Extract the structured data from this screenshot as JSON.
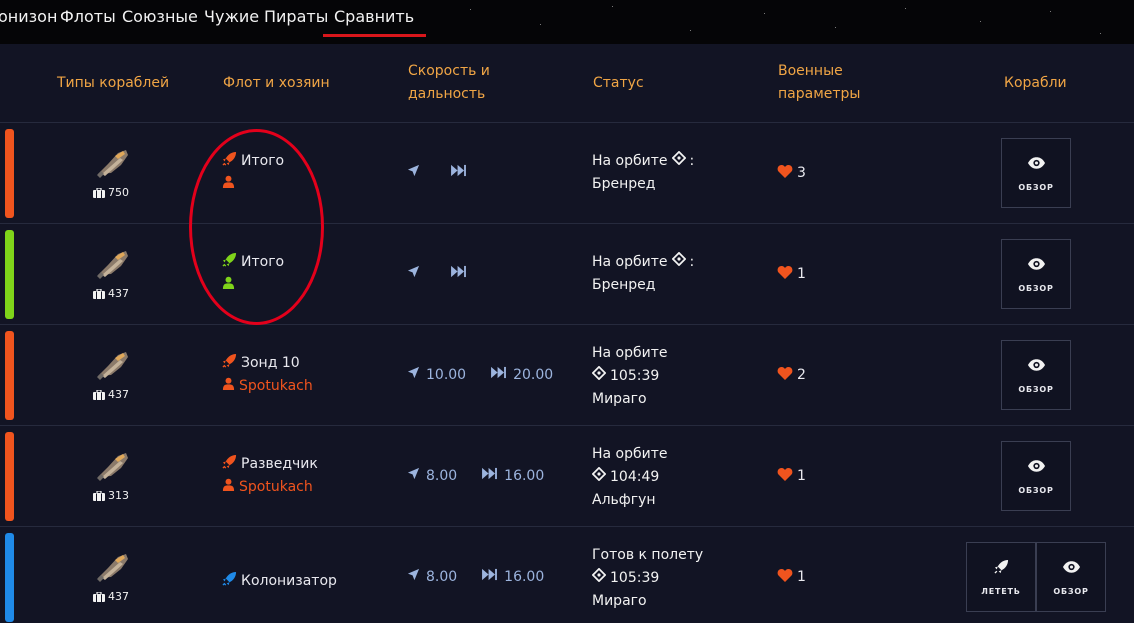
{
  "tabs": [
    "онизон",
    "Флоты",
    "Союзные",
    "Чужие",
    "Пираты",
    "Сравнить"
  ],
  "active_tab": "Сравнить",
  "columns": {
    "types": "Типы кораблей",
    "fleet": "Флот и хозяин",
    "speed": "Скорость и дальность",
    "status": "Статус",
    "military": "Военные параметры",
    "ships": "Корабли"
  },
  "colors": {
    "orange": "#f0541e",
    "green": "#7fd41a",
    "blue": "#1f8ae8",
    "accent_header": "#f0a545",
    "underline": "#d8161b"
  },
  "rows": [
    {
      "stripe": "orange",
      "cargo": "750",
      "fleet_name": "Итого",
      "owner": "",
      "speed": "",
      "range": "",
      "status": [
        "На орбите",
        ":",
        "Бренред"
      ],
      "hp": "3",
      "buttons": [
        "ОБЗОР"
      ]
    },
    {
      "stripe": "green",
      "cargo": "437",
      "fleet_name": "Итого",
      "owner": "",
      "speed": "",
      "range": "",
      "status": [
        "На орбите",
        ":",
        "Бренред"
      ],
      "hp": "1",
      "buttons": [
        "ОБЗОР"
      ]
    },
    {
      "stripe": "orange",
      "cargo": "437",
      "fleet_name": "Зонд 10",
      "owner": "Spotukach",
      "speed": "10.00",
      "range": "20.00",
      "status": [
        "На орбите",
        "105:39",
        "Мираго"
      ],
      "hp": "2",
      "buttons": [
        "ОБЗОР"
      ]
    },
    {
      "stripe": "orange",
      "cargo": "313",
      "fleet_name": "Разведчик",
      "owner": "Spotukach",
      "speed": "8.00",
      "range": "16.00",
      "status": [
        "На орбите",
        "104:49",
        "Альфгун"
      ],
      "hp": "1",
      "buttons": [
        "ОБЗОР"
      ]
    },
    {
      "stripe": "blue",
      "cargo": "437",
      "fleet_name": "Колонизатор",
      "owner": "",
      "speed": "8.00",
      "range": "16.00",
      "status": [
        "Готов к полету",
        "105:39",
        "Мираго"
      ],
      "hp": "1",
      "buttons": [
        "ЛЕТЕТЬ",
        "ОБЗОР"
      ]
    }
  ],
  "icons": {
    "ship": "ship-sprite-icon",
    "cargo": "briefcase-icon",
    "fleet": "rocket-icon",
    "owner": "user-icon",
    "speed": "arrow-icon",
    "range": "fast-forward-icon",
    "position": "crosshair-icon",
    "hp": "heart-icon",
    "view": "eye-icon",
    "fly": "rocket-icon"
  }
}
